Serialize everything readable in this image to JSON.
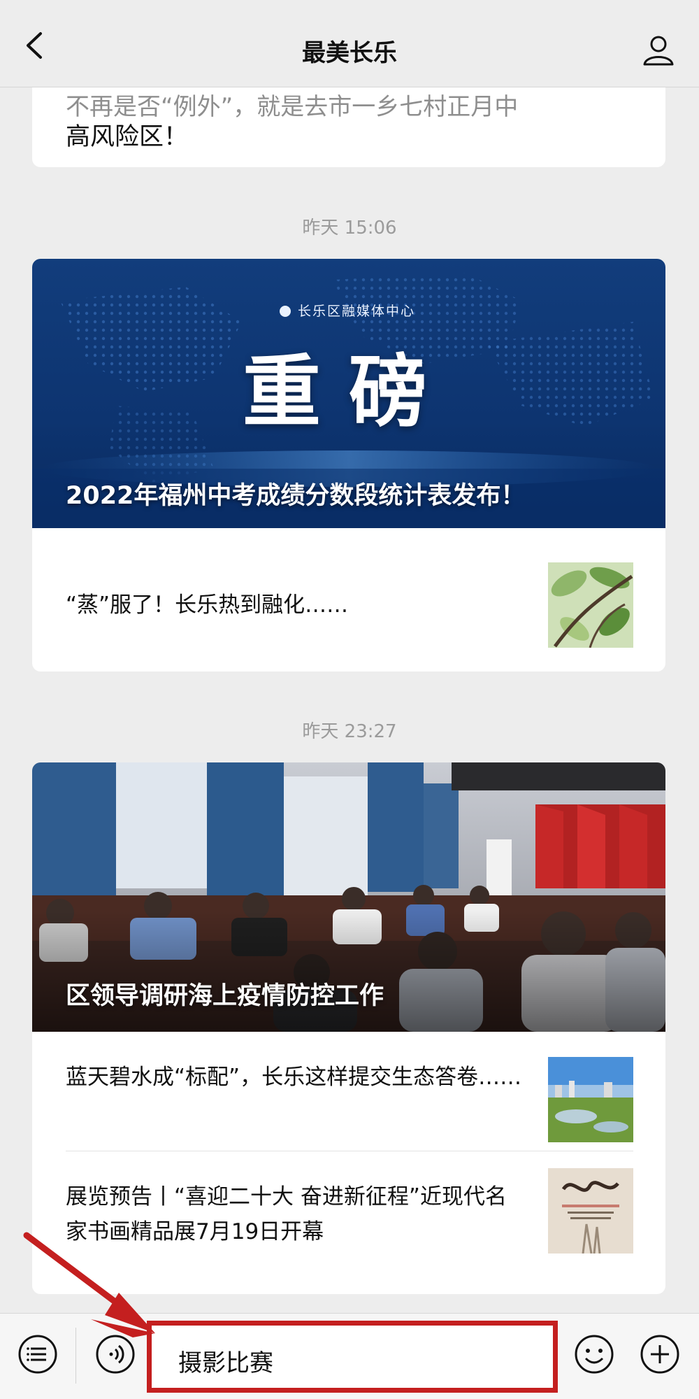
{
  "header": {
    "title": "最美长乐",
    "back_icon": "chevron-left-icon",
    "profile_icon": "person-icon"
  },
  "feed": {
    "previous_article": {
      "cut_text": "不再是否“例外”，就是去市一乡七村正月中",
      "tail_text": "高风险区！"
    },
    "groups": [
      {
        "time": "昨天 15:06",
        "headline": {
          "banner_org": "长乐区融媒体中心",
          "banner_word": "重磅",
          "title": "2022年福州中考成绩分数段统计表发布！"
        },
        "items": [
          {
            "title": "“蒸”服了！长乐热到融化……"
          }
        ]
      },
      {
        "time": "昨天 23:27",
        "headline": {
          "title": "区领导调研海上疫情防控工作"
        },
        "items": [
          {
            "title": "蓝天碧水成“标配”，长乐这样提交生态答卷……"
          },
          {
            "title": "展览预告丨“喜迎二十大 奋进新征程”近现代名家书画精品展7月19日开幕"
          }
        ]
      }
    ]
  },
  "bottom_bar": {
    "menu_icon": "menu-list-icon",
    "voice_icon": "voice-icon",
    "input_value": "摄影比赛",
    "emoji_icon": "emoji-icon",
    "plus_icon": "plus-icon"
  },
  "colors": {
    "annotation_red": "#c41f1f",
    "banner_blue": "#0f3f86",
    "background": "#ededed"
  }
}
